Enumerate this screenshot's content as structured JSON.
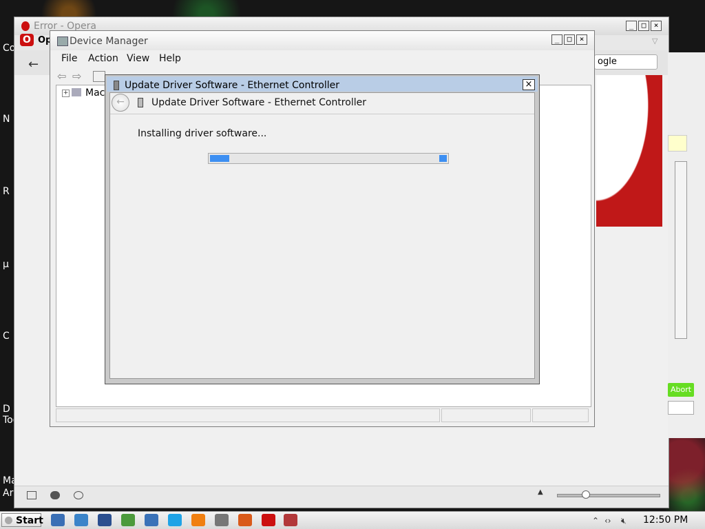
{
  "desktop": {
    "icon_labels": [
      "Co",
      "N",
      "R",
      "µ",
      "C",
      "D",
      "Too",
      "Ma",
      "Ar"
    ]
  },
  "opera": {
    "title": "Error - Opera",
    "menu_label": "Op",
    "search_text": "ogle",
    "abort_label": "Abort"
  },
  "device_manager": {
    "title": "Device Manager",
    "menu": [
      "File",
      "Action",
      "View",
      "Help"
    ],
    "tree_root": "Mac"
  },
  "dialog": {
    "title": "Update Driver Software - Ethernet Controller",
    "heading": "Update Driver Software - Ethernet Controller",
    "status": "Installing driver software...",
    "progress_indeterminate": true,
    "progress_chunk_fraction": 0.08
  },
  "taskbar": {
    "start_label": "Start",
    "clock": "12:50 PM",
    "apps": [
      {
        "icon": "network-icon",
        "color": "#3a6fb5"
      },
      {
        "icon": "window-icon",
        "color": "#3b84c9"
      },
      {
        "icon": "search-icon",
        "color": "#2b4f8f"
      },
      {
        "icon": "image-viewer-icon",
        "color": "#4c9a3c"
      },
      {
        "icon": "network-places-icon",
        "color": "#3a72b8"
      },
      {
        "icon": "skype-icon",
        "color": "#1fa3e6"
      },
      {
        "icon": "vlc-icon",
        "color": "#f07f10"
      },
      {
        "icon": "chat-icon",
        "color": "#777777"
      },
      {
        "icon": "firefox-icon",
        "color": "#d95a1a"
      },
      {
        "icon": "opera-icon",
        "color": "#cc1010"
      },
      {
        "icon": "device-manager-icon",
        "color": "#b2383a"
      }
    ],
    "tray_icons": [
      "show-hidden-icon",
      "network-activity-icon",
      "volume-muted-icon"
    ]
  }
}
